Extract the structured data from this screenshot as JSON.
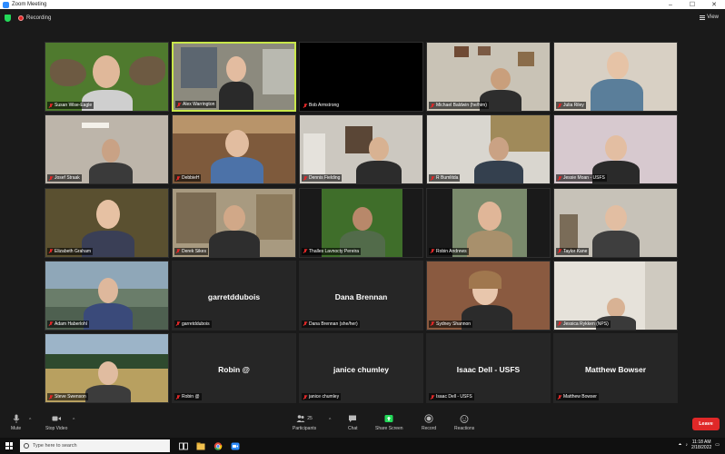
{
  "window": {
    "title": "Zoom Meeting"
  },
  "topbar": {
    "recording_label": "Recording",
    "view_label": "View"
  },
  "participants": [
    {
      "name": "Susan Wise-Eagle"
    },
    {
      "name": "Alex Warrington"
    },
    {
      "name": "Bob Armstrong"
    },
    {
      "name": "Michael Baldwin (he/him)"
    },
    {
      "name": "Julia Riley"
    },
    {
      "name": "Josef Straak"
    },
    {
      "name": "DebbieH"
    },
    {
      "name": "Dennis Fielding"
    },
    {
      "name": "R Bumlitda"
    },
    {
      "name": "Jessie Moan - USFS"
    },
    {
      "name": "Elizabeth Graham"
    },
    {
      "name": "Derek Sikes"
    },
    {
      "name": "Thalles Lavnocty Pereira"
    },
    {
      "name": "Robin Andrews"
    },
    {
      "name": "Taylor Kane"
    },
    {
      "name": "Adam Haberlohl"
    },
    {
      "name": "garretddubois",
      "display": "garretddubois"
    },
    {
      "name": "Dana Brennan (she/her)",
      "display": "Dana Brennan"
    },
    {
      "name": "Sydney Shannon"
    },
    {
      "name": "Jessica Rykken (NPS)"
    },
    {
      "name": "Steve Swenson"
    },
    {
      "name": "Robin @",
      "display": "Robin @"
    },
    {
      "name": "janice chumley",
      "display": "janice chumley"
    },
    {
      "name": "Isaac Dell - USFS",
      "display": "Isaac Dell - USFS"
    },
    {
      "name": "Matthew Bowser",
      "display": "Matthew Bowser"
    }
  ],
  "toolbar": {
    "mute_label": "Mute",
    "video_label": "Stop Video",
    "participants_label": "Participants",
    "participants_count": "25",
    "chat_label": "Chat",
    "share_label": "Share Screen",
    "record_label": "Record",
    "reactions_label": "Reactions",
    "leave_label": "Leave"
  },
  "taskbar": {
    "search_placeholder": "Type here to search",
    "time": "11:18 AM",
    "date": "2/18/2022"
  },
  "colors": {
    "accent": "#2d8cff",
    "share_green": "#23d959",
    "leave_red": "#e02828",
    "active_border": "#c8e64a"
  }
}
